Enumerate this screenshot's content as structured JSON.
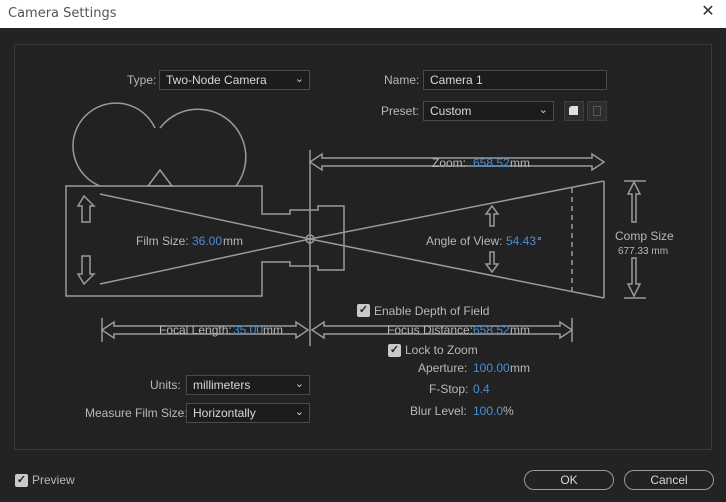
{
  "window": {
    "title": "Camera Settings",
    "close_glyph": "✕"
  },
  "type": {
    "label": "Type:",
    "value": "Two-Node Camera"
  },
  "name": {
    "label": "Name:",
    "value": "Camera 1"
  },
  "preset": {
    "label": "Preset:",
    "value": "Custom"
  },
  "diagram": {
    "zoom_label": "Zoom:",
    "zoom_value": "658.52",
    "zoom_unit": "mm",
    "film_size_label": "Film Size:",
    "film_size_value": "36.00",
    "film_size_unit": "mm",
    "angle_label": "Angle of View:",
    "angle_value": "54.43",
    "angle_unit": "°",
    "comp_size_label": "Comp Size",
    "comp_size_value": "677.33 mm",
    "focal_length_label": "Focal Length:",
    "focal_length_value": "35.00",
    "focal_length_unit": "mm",
    "focus_distance_label": "Focus Distance:",
    "focus_distance_value": "658.52",
    "focus_distance_unit": "mm"
  },
  "dof": {
    "enable_label": "Enable Depth of Field",
    "enable_checked": true,
    "lock_label": "Lock to Zoom",
    "lock_checked": true,
    "aperture_label": "Aperture:",
    "aperture_value": "100.00",
    "aperture_unit": "mm",
    "fstop_label": "F-Stop:",
    "fstop_value": "0.4",
    "blur_label": "Blur Level:",
    "blur_value": "100.0",
    "blur_unit": "%"
  },
  "units": {
    "label": "Units:",
    "value": "millimeters"
  },
  "measure": {
    "label": "Measure Film Size:",
    "value": "Horizontally"
  },
  "footer": {
    "preview_label": "Preview",
    "preview_checked": true,
    "ok_label": "OK",
    "cancel_label": "Cancel"
  },
  "check_glyph": "✓",
  "chevron_glyph": "⌄",
  "colors": {
    "value_blue": "#4a8fd6",
    "diagram_line": "#9a9a9a",
    "background": "#232323"
  },
  "icons": [
    "close-icon",
    "chevron-down-icon",
    "new-preset-icon",
    "delete-preset-icon",
    "checkbox-icon"
  ]
}
